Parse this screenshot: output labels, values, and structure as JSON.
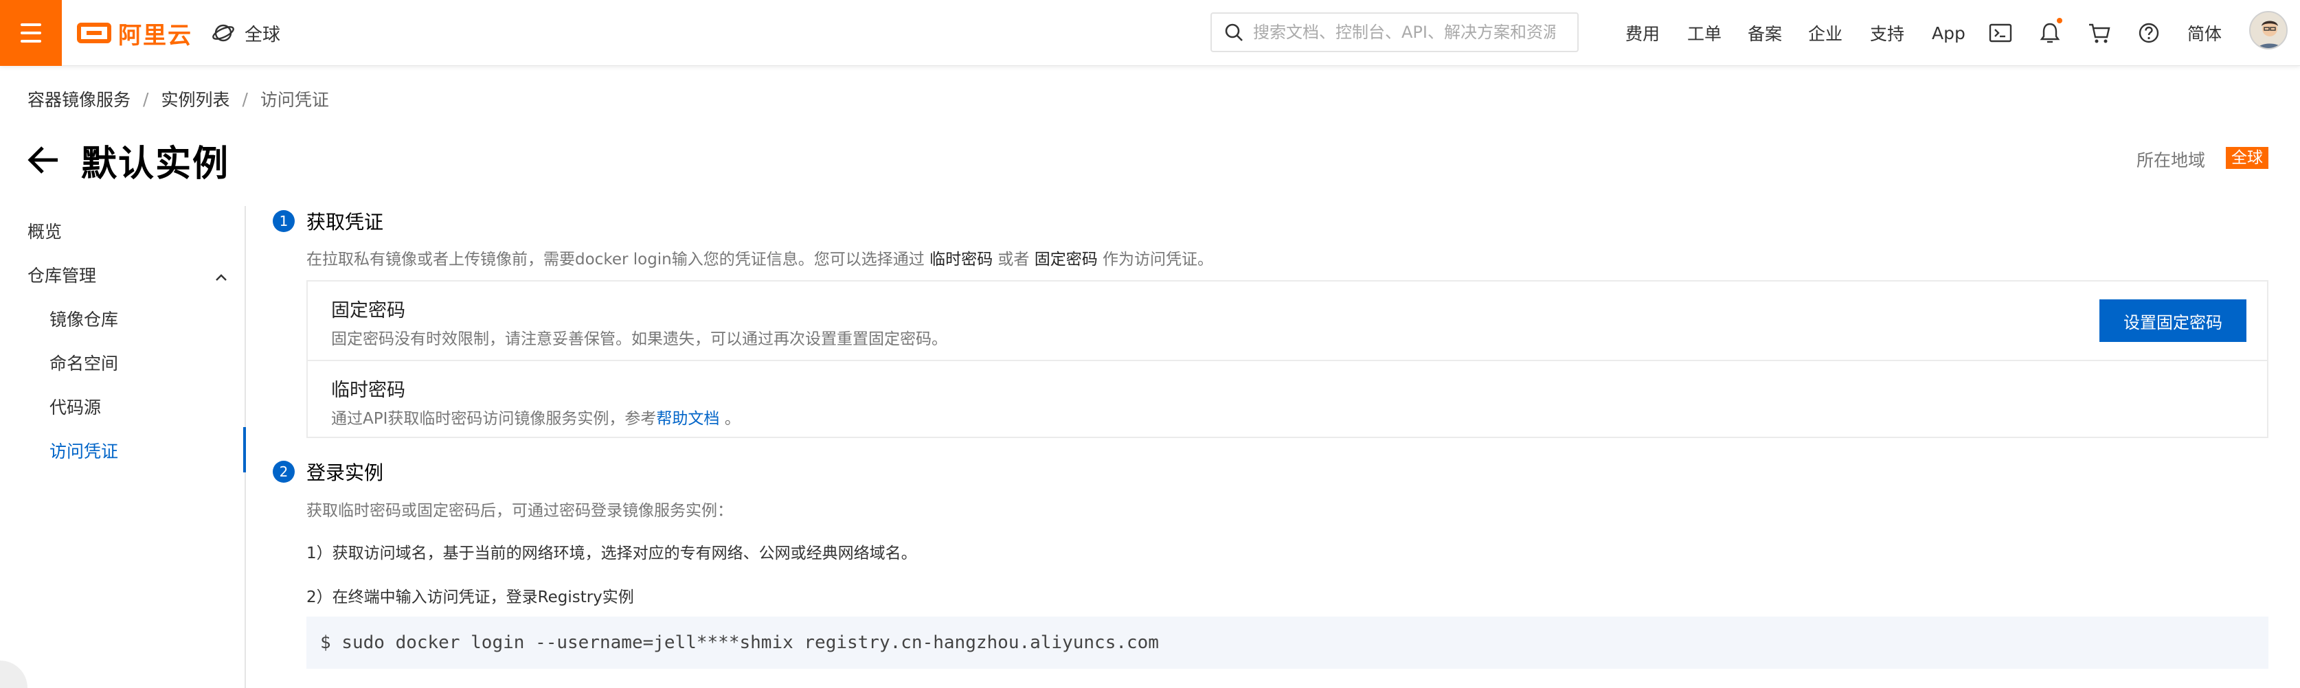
{
  "colors": {
    "brand": "#ff6a00",
    "primary": "#0064c8"
  },
  "topbar": {
    "logo_text": "阿里云",
    "region": "全球",
    "search_placeholder": "搜索文档、控制台、API、解决方案和资源",
    "nav": [
      "费用",
      "工单",
      "备案",
      "企业",
      "支持",
      "App"
    ],
    "lang": "简体",
    "icons": [
      "terminal-icon",
      "bell-icon",
      "cart-icon",
      "help-icon"
    ]
  },
  "breadcrumb": [
    "容器镜像服务",
    "实例列表",
    "访问凭证"
  ],
  "page": {
    "title": "默认实例",
    "region_label": "所在地域",
    "region_value": "全球"
  },
  "sidebar": {
    "items": [
      "概览",
      "仓库管理",
      "镜像仓库",
      "命名空间",
      "代码源",
      "访问凭证"
    ]
  },
  "step1": {
    "num": "1",
    "title": "获取凭证",
    "desc_a": "在拉取私有镜像或者上传镜像前，需要docker login输入您的凭证信息。您可以选择通过",
    "desc_b": "临时密码",
    "desc_c": "或者",
    "desc_d": "固定密码",
    "desc_e": "作为访问凭证。",
    "fixed_title": "固定密码",
    "fixed_desc": "固定密码没有时效限制，请注意妥善保管。如果遗失，可以通过再次设置重置固定密码。",
    "fixed_button": "设置固定密码",
    "temp_title": "临时密码",
    "temp_desc": "通过API获取临时密码访问镜像服务实例，参考",
    "temp_link": "帮助文档",
    "temp_end": "。"
  },
  "step2": {
    "num": "2",
    "title": "登录实例",
    "desc": "获取临时密码或固定密码后，可通过密码登录镜像服务实例：",
    "line1": "1）获取访问域名，基于当前的网络环境，选择对应的专有网络、公网或经典网络域名。",
    "line2": "2）在终端中输入访问凭证，登录Registry实例",
    "command": "$ sudo docker login --username=jell****shmix registry.cn-hangzhou.aliyuncs.com"
  }
}
